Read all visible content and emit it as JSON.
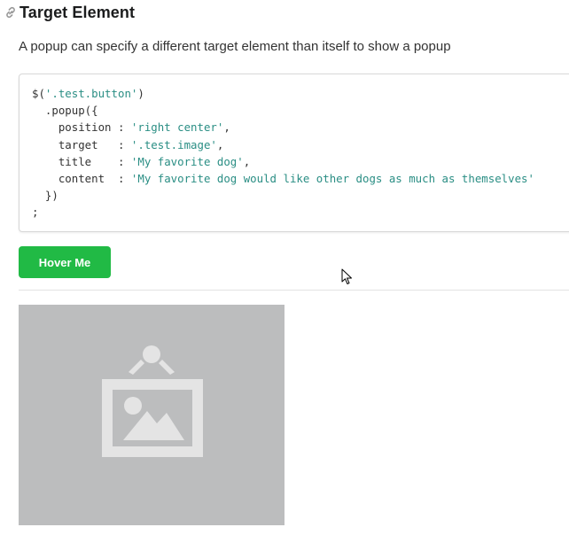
{
  "heading": {
    "title": "Target Element",
    "icon": "link-icon"
  },
  "description": "A popup can specify a different target element than itself to show a popup",
  "code": {
    "line1_pre": "$(",
    "line1_str": "'.test.button'",
    "line1_post": ")",
    "line2": "  .popup({",
    "line3_key": "    position : ",
    "line3_str": "'right center'",
    "line3_post": ",",
    "line4_key": "    target   : ",
    "line4_str": "'.test.image'",
    "line4_post": ",",
    "line5_key": "    title    : ",
    "line5_str": "'My favorite dog'",
    "line5_post": ",",
    "line6_key": "    content  : ",
    "line6_str": "'My favorite dog would like other dogs as much as themselves'",
    "line7": "  })",
    "line8": ";"
  },
  "button": {
    "label": "Hover Me",
    "color": "#21ba45"
  },
  "image": {
    "icon": "image-placeholder-icon",
    "background": "#bcbdbe"
  },
  "colors": {
    "string": "#2a8e84"
  }
}
